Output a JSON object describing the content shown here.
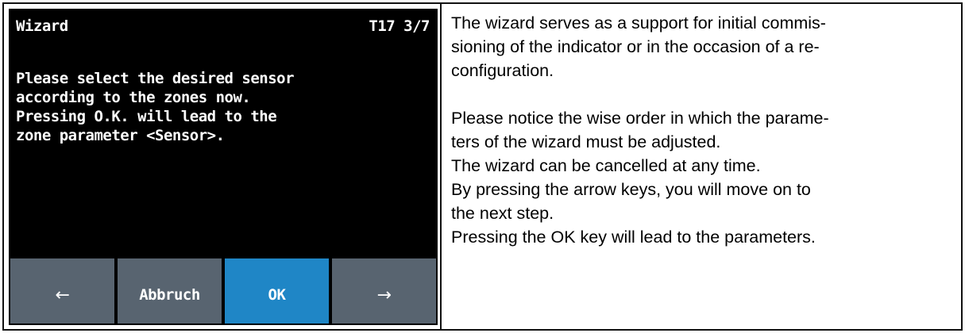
{
  "device": {
    "title": "Wizard",
    "code": "T17 3/7",
    "message_lines": [
      "Please select the desired sensor",
      "according to the zones now.",
      "Pressing O.K. will lead to the",
      "zone parameter <Sensor>."
    ],
    "softkeys": {
      "back": "←",
      "cancel": "Abbruch",
      "ok": "OK",
      "next": "→"
    }
  },
  "description": {
    "para1_lines": [
      "The wizard serves as a support for initial commis-",
      "sioning of the indicator or in the occasion of a re-",
      "configuration."
    ],
    "para2_lines": [
      "Please notice the wise order in which the parame-",
      "ters of the wizard must be adjusted.",
      "The wizard can be cancelled at any time.",
      "By pressing the arrow keys, you will move on to",
      "the next step.",
      "Pressing the OK key will lead to the parameters."
    ]
  },
  "colors": {
    "screen_background": "#000000",
    "softkey_gray": "#586470",
    "softkey_ok_blue": "#1f86c6",
    "screen_text": "#ffffff"
  }
}
